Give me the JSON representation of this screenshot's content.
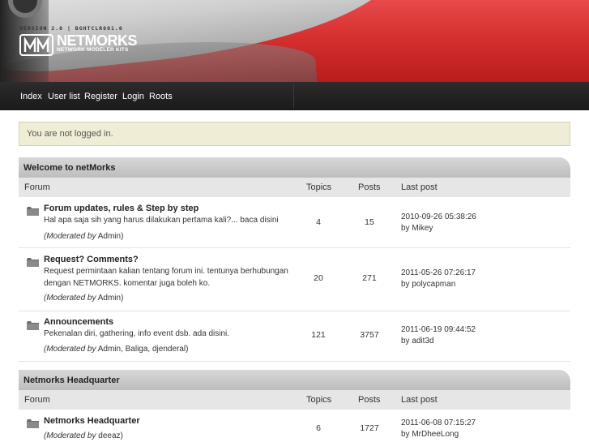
{
  "brand": {
    "version": "VERSION 2.0  |  BGHTCLR001.0",
    "name": "NETMORKS",
    "tagline": "NETWORK MODELER KITS"
  },
  "nav": [
    "Index",
    "User list",
    "Register",
    "Login",
    "Roots"
  ],
  "notice": "You are not logged in.",
  "columns": {
    "forum": "Forum",
    "topics": "Topics",
    "posts": "Posts",
    "last_post": "Last post"
  },
  "moderated_label": "(Moderated by",
  "categories": [
    {
      "title": "Welcome to netMorks",
      "forums": [
        {
          "title": "Forum updates, rules & Step by step",
          "desc": "Hal apa saja sih yang harus dilakukan pertama kali?... baca disini",
          "moderators": "Admin)",
          "topics": "4",
          "posts": "15",
          "last_date": "2010-09-26 05:38:26",
          "last_by": "by Mikey"
        },
        {
          "title": "Request? Comments?",
          "desc": "Request permintaan kalian tentang forum ini. tentunya berhubungan dengan NETMORKS. komentar juga boleh ko.",
          "moderators": "Admin)",
          "topics": "20",
          "posts": "271",
          "last_date": "2011-05-26 07:26:17",
          "last_by": "by polycapman"
        },
        {
          "title": "Announcements",
          "desc": "Pekenalan diri, gathering, info event dsb. ada disini.",
          "moderators": "Admin, Baliga, djenderal)",
          "topics": "121",
          "posts": "3757",
          "last_date": "2011-06-19 09:44:52",
          "last_by": "by adit3d"
        }
      ]
    },
    {
      "title": "Netmorks Headquarter",
      "forums": [
        {
          "title": "Netmorks Headquarter",
          "desc": "",
          "moderators": "deeaz)",
          "topics": "6",
          "posts": "1727",
          "last_date": "2011-06-08 07:15:27",
          "last_by": "by MrDheeLong"
        }
      ]
    }
  ],
  "colors": {
    "banner_red": "#d63030",
    "nav_bg": "#1f1f1f",
    "notice_bg": "#efedd6",
    "header_gray": "#c8c8c8"
  },
  "icons": [
    "folder-icon",
    "netmorks-logo-icon"
  ]
}
